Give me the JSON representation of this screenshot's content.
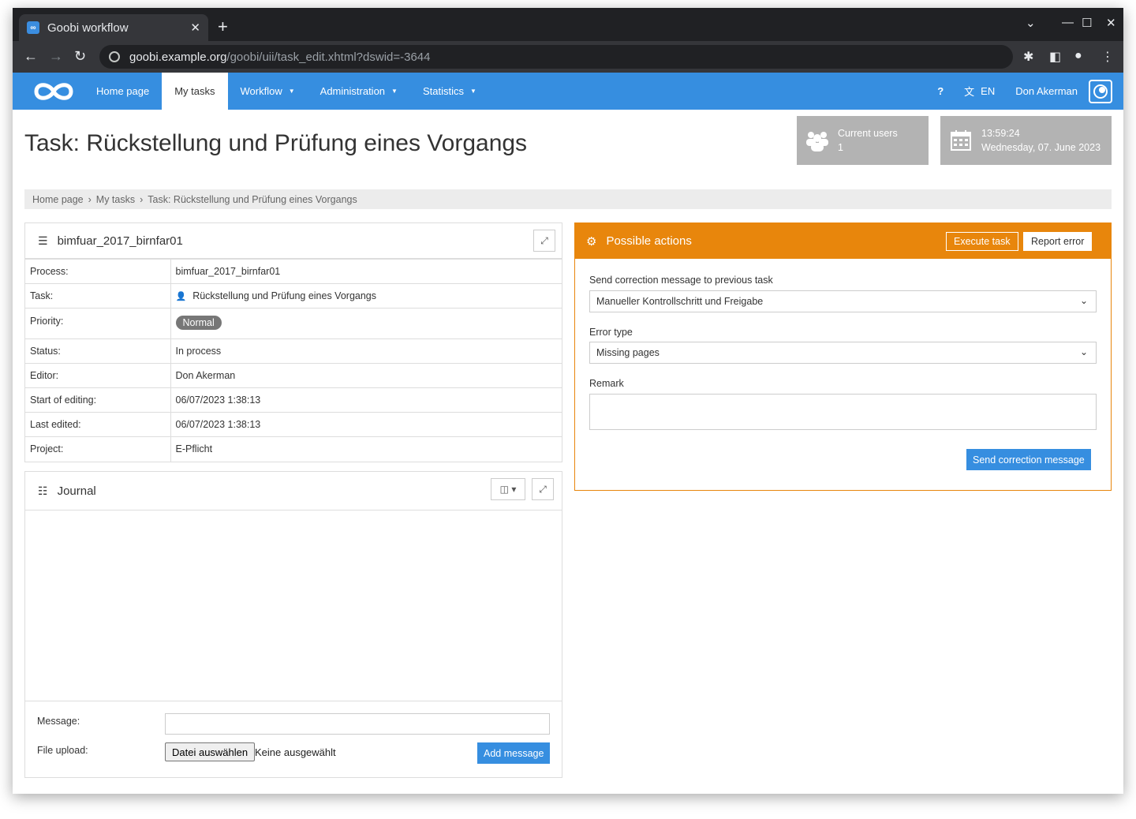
{
  "browser": {
    "tab_title": "Goobi workflow",
    "favicon_text": "∞",
    "url_host": "goobi.example.org",
    "url_path": "/goobi/uii/task_edit.xhtml?dswid=-3644"
  },
  "navbar": {
    "items": [
      {
        "label": "Home page"
      },
      {
        "label": "My tasks"
      },
      {
        "label": "Workflow"
      },
      {
        "label": "Administration"
      },
      {
        "label": "Statistics"
      }
    ],
    "help": "?",
    "language": "EN",
    "user": "Don Akerman",
    "accent": "#368ee0"
  },
  "page": {
    "title": "Task: Rückstellung und Prüfung eines Vorgangs",
    "current_users_label": "Current users",
    "current_users_count": "1",
    "time": "13:59:24",
    "date": "Wednesday, 07. June 2023"
  },
  "breadcrumb": [
    "Home page",
    "My tasks",
    "Task: Rückstellung und Prüfung eines Vorgangs"
  ],
  "details": {
    "title": "bimfuar_2017_birnfar01",
    "rows": [
      {
        "label": "Process:",
        "value": "bimfuar_2017_birnfar01"
      },
      {
        "label": "Task:",
        "value": "Rückstellung und Prüfung eines Vorgangs"
      },
      {
        "label": "Priority:",
        "value": "Normal"
      },
      {
        "label": "Status:",
        "value": "In process"
      },
      {
        "label": "Editor:",
        "value": "Don Akerman"
      },
      {
        "label": "Start of editing:",
        "value": "06/07/2023 1:38:13"
      },
      {
        "label": "Last edited:",
        "value": "06/07/2023 1:38:13"
      },
      {
        "label": "Project:",
        "value": "E-Pflicht"
      }
    ]
  },
  "journal": {
    "title": "Journal",
    "message_label": "Message:",
    "file_label": "File upload:",
    "file_button": "Datei auswählen",
    "file_none": "Keine ausgewählt",
    "add_button": "Add message"
  },
  "actions": {
    "title": "Possible actions",
    "execute": "Execute task",
    "report": "Report error",
    "correction_label": "Send correction message to previous task",
    "correction_value": "Manueller Kontrollschritt und Freigabe",
    "error_label": "Error type",
    "error_value": "Missing pages",
    "remark_label": "Remark",
    "send_button": "Send correction message",
    "header_color": "#e8860c"
  }
}
